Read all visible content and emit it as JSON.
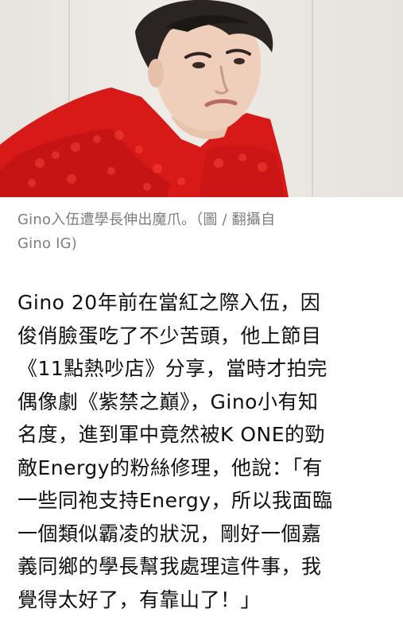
{
  "caption": {
    "line1": "Gino入伍遭學長伸出魔爪。（圖 / 翻攝自",
    "line2": "Gino IG)"
  },
  "article": {
    "lines": [
      "Gino 20年前在當紅之際入伍，因",
      "俊俏臉蛋吃了不少苦頭，他上節目",
      "《11點熱吵店》分享，當時才拍完",
      "偶像劇《紫禁之巔》，Gino小有知",
      "名度，進到軍中竟然被K ONE的勁",
      "敵Energy的粉絲修理，他說：「有",
      "一些同袍支持Energy，所以我面臨",
      "一個類似霸凌的狀況，剛好一個嘉",
      "義同鄉的學長幫我處理這件事，我",
      "覺得太好了，有靠山了！」"
    ]
  }
}
